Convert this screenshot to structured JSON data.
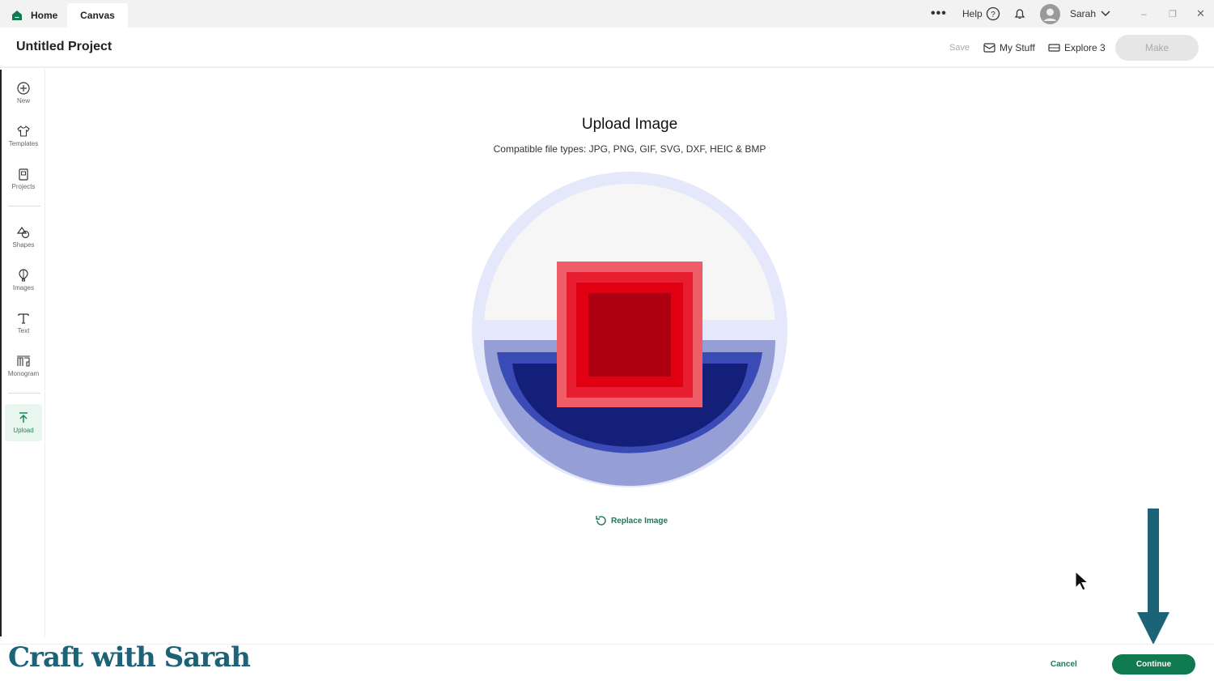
{
  "tabs": {
    "home": "Home",
    "canvas": "Canvas"
  },
  "topbar": {
    "help": "Help",
    "user": "Sarah"
  },
  "header": {
    "title": "Untitled Project",
    "save": "Save",
    "my_stuff": "My Stuff",
    "machine": "Explore 3",
    "make": "Make"
  },
  "sidebar": [
    {
      "label": "New"
    },
    {
      "label": "Templates"
    },
    {
      "label": "Projects"
    },
    {
      "label": "Shapes"
    },
    {
      "label": "Images"
    },
    {
      "label": "Text"
    },
    {
      "label": "Monogram"
    },
    {
      "label": "Upload"
    }
  ],
  "main": {
    "title": "Upload Image",
    "subtitle": "Compatible file types:  JPG, PNG, GIF, SVG, DXF, HEIC & BMP",
    "replace": "Replace Image"
  },
  "footer": {
    "cancel": "Cancel",
    "continue": "Continue"
  },
  "watermark": "Craft with Sarah",
  "colors": {
    "accent": "#0f7a4f",
    "arrow": "#1c6378"
  }
}
